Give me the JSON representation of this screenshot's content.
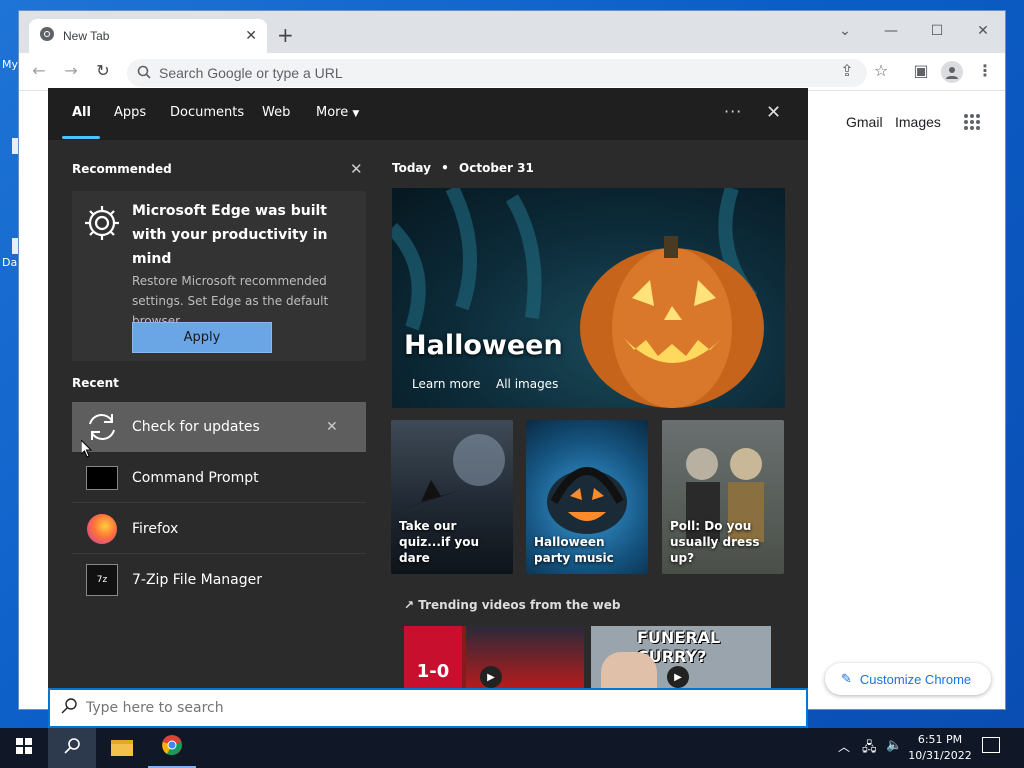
{
  "desktop": {
    "labels": [
      "My",
      "Da"
    ]
  },
  "chrome": {
    "tab_title": "New Tab",
    "address_placeholder": "Search Google or type a URL",
    "gmail": "Gmail",
    "images": "Images",
    "customize": "Customize Chrome"
  },
  "search_panel": {
    "tabs": [
      "All",
      "Apps",
      "Documents",
      "Web",
      "More"
    ],
    "recommended_heading": "Recommended",
    "card": {
      "title": "Microsoft Edge was built with your productivity in mind",
      "body": "Restore Microsoft recommended settings. Set Edge as the default browser.",
      "button": "Apply"
    },
    "recent_heading": "Recent",
    "recent": [
      "Check for updates",
      "Command Prompt",
      "Firefox",
      "7-Zip File Manager"
    ],
    "today_label": "Today",
    "date": "October 31",
    "hero": {
      "title": "Halloween",
      "learn_more": "Learn more",
      "all_images": "All images"
    },
    "tiles": [
      "Take our quiz...if you dare",
      "Halloween party music",
      "Poll: Do you usually dress up?"
    ],
    "trending": "Trending videos from the web",
    "videos": [
      {
        "overlay": "1-0"
      },
      {
        "overlay": "FUNERAL CURRY?"
      }
    ],
    "search_placeholder": "Type here to search"
  },
  "taskbar": {
    "time": "6:51 PM",
    "date": "10/31/2022"
  },
  "colors": {
    "accent": "#0078d4",
    "panel": "#2b2b2b",
    "apply": "#6aa5e6",
    "chrome_blue": "#1a73e8"
  }
}
